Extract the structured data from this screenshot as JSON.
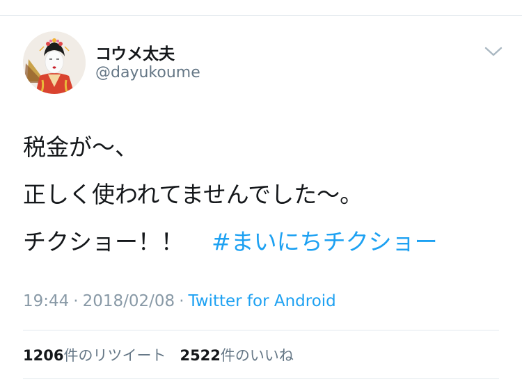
{
  "author": {
    "display_name": "コウメ太夫",
    "handle": "@dayukoume",
    "avatar_icon": "user-avatar"
  },
  "tweet": {
    "lines": [
      "税金が〜、",
      "正しく使われてませんでした〜。",
      "チクショー！！"
    ],
    "hashtag": "#まいにちチクショー"
  },
  "meta": {
    "time": "19:44",
    "separator": "·",
    "date": "2018/02/08",
    "source": "Twitter for Android"
  },
  "stats": {
    "retweets_count": "1206",
    "retweets_label": "件のリツイート",
    "likes_count": "2522",
    "likes_label": "件のいいね"
  },
  "colors": {
    "link": "#1da1f2",
    "text": "#14171a",
    "secondary": "#8899a6",
    "divider": "#e1e8ed"
  },
  "icons": {
    "more_menu": "chevron-down-icon"
  }
}
